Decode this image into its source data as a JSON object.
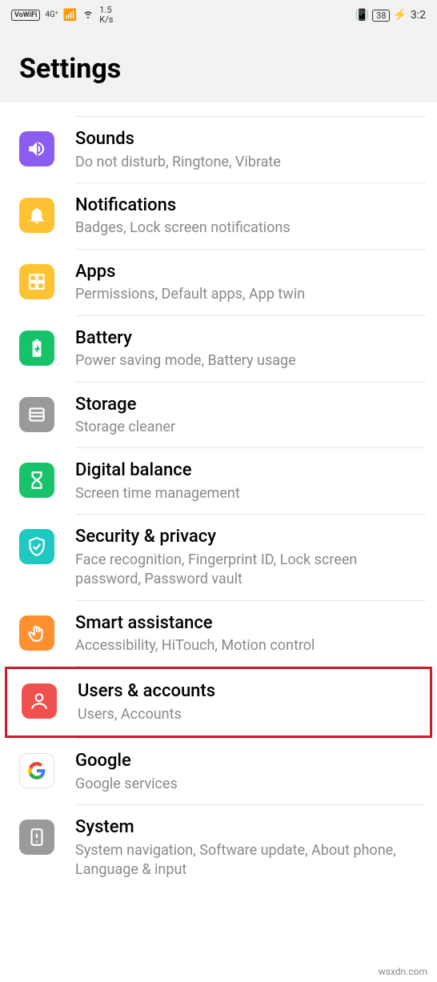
{
  "status": {
    "vowifi": "VoWiFi",
    "network": "4G⁺",
    "speed_top": "1.5",
    "speed_bottom": "K/s",
    "battery": "38",
    "time": "3:2"
  },
  "header": {
    "title": "Settings"
  },
  "items": [
    {
      "title": "Sounds",
      "subtitle": "Do not disturb, Ringtone, Vibrate",
      "icon": "sound-icon",
      "bg": "bg-purple"
    },
    {
      "title": "Notifications",
      "subtitle": "Badges, Lock screen notifications",
      "icon": "bell-icon",
      "bg": "bg-yellow"
    },
    {
      "title": "Apps",
      "subtitle": "Permissions, Default apps, App twin",
      "icon": "apps-icon",
      "bg": "bg-yellow"
    },
    {
      "title": "Battery",
      "subtitle": "Power saving mode, Battery usage",
      "icon": "battery-icon",
      "bg": "bg-green1"
    },
    {
      "title": "Storage",
      "subtitle": "Storage cleaner",
      "icon": "storage-icon",
      "bg": "bg-gray"
    },
    {
      "title": "Digital balance",
      "subtitle": "Screen time management",
      "icon": "hourglass-icon",
      "bg": "bg-green1"
    },
    {
      "title": "Security & privacy",
      "subtitle": "Face recognition, Fingerprint ID, Lock screen password, Password vault",
      "icon": "shield-icon",
      "bg": "bg-teal"
    },
    {
      "title": "Smart assistance",
      "subtitle": "Accessibility, HiTouch, Motion control",
      "icon": "hand-icon",
      "bg": "bg-orange"
    },
    {
      "title": "Users & accounts",
      "subtitle": "Users, Accounts",
      "icon": "user-icon",
      "bg": "bg-red",
      "highlight": true
    },
    {
      "title": "Google",
      "subtitle": "Google services",
      "icon": "google-icon",
      "bg": "bg-white"
    },
    {
      "title": "System",
      "subtitle": "System navigation, Software update, About phone, Language & input",
      "icon": "system-icon",
      "bg": "bg-gray"
    }
  ],
  "watermark": "wsxdn.com"
}
